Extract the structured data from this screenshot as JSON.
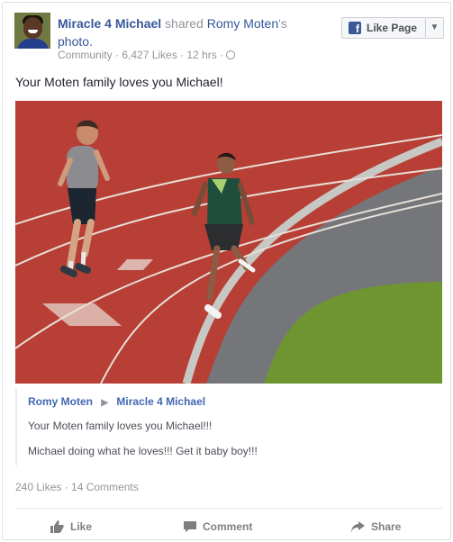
{
  "post": {
    "author": "Miracle 4 Michael",
    "shared_text": " shared ",
    "shared_name": "Romy Moten",
    "possessive": "'s",
    "object": "photo.",
    "meta": "Community · 6,427 Likes · 12 hrs ·",
    "text": "Your Moten family loves you Michael!",
    "like_page_label": "Like Page",
    "dropdown": "▼",
    "stats": "240 Likes · 14 Comments"
  },
  "shared_post": {
    "from": "Romy Moten",
    "arrow": "▶",
    "to": "Miracle 4 Michael",
    "line1": "Your Moten family loves you Michael!!!",
    "line2": "Michael doing what he loves!!! Get it baby boy!!!"
  },
  "actions": {
    "like": "Like",
    "comment": "Comment",
    "share": "Share"
  },
  "icons": {
    "facebook": "f",
    "globe": "globe-icon",
    "like": "thumb-up-icon",
    "comment": "speech-bubble-icon",
    "share": "share-arrow-icon"
  },
  "colors": {
    "link": "#365899",
    "muted": "#90949c",
    "facebook_blue": "#3b5998",
    "track": "#b83d34",
    "grass": "#6f9531"
  }
}
